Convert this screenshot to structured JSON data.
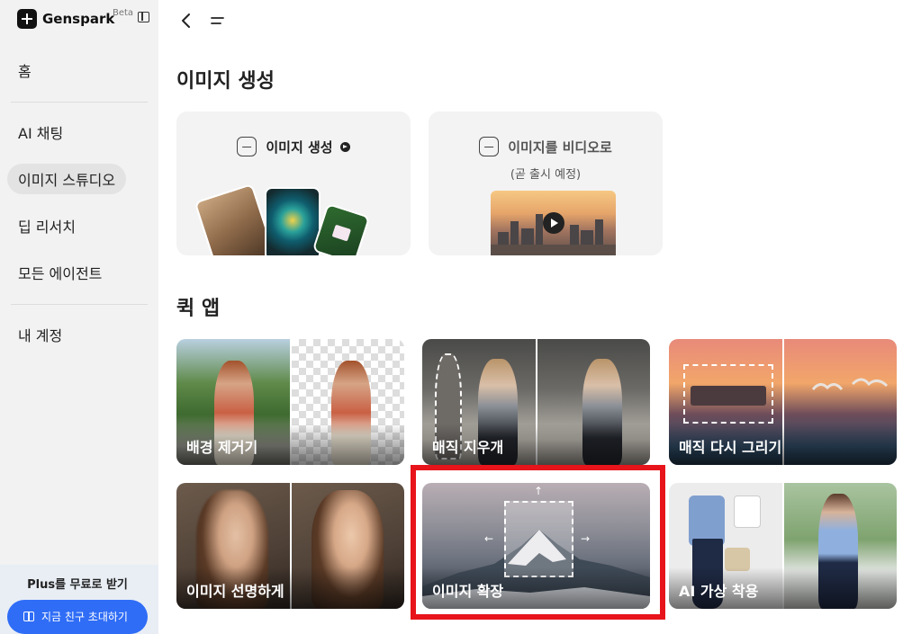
{
  "sidebar": {
    "brand_name": "Genspark",
    "beta_badge": "Beta",
    "items": [
      {
        "label": "홈"
      },
      {
        "label": "AI 채팅"
      },
      {
        "label": "이미지 스튜디오"
      },
      {
        "label": "딥 리서치"
      },
      {
        "label": "모든 에이전트"
      },
      {
        "label": "내 계정"
      }
    ],
    "active_item": "이미지 스튜디오",
    "promo": {
      "title": "Plus를 무료로 받기",
      "button_label": "지금 친구 초대하기"
    }
  },
  "main": {
    "image_gen_title": "이미지 생성",
    "cards": [
      {
        "label": "이미지 생성"
      },
      {
        "label": "이미지를 비디오로",
        "sublabel": "(곧 출시 예정)"
      }
    ],
    "quick_apps_title": "퀵 앱",
    "quick_apps": [
      {
        "label": "배경 제거기"
      },
      {
        "label": "매직 지우개"
      },
      {
        "label": "매직 다시 그리기"
      },
      {
        "label": "이미지 선명하게"
      },
      {
        "label": "이미지 확장"
      },
      {
        "label": "AI 가상 착용"
      }
    ],
    "highlighted_app": "이미지 확장"
  },
  "colors": {
    "highlight_border": "#e8141b",
    "promo_button": "#2f6df6",
    "sidebar_bg": "#f2f2f2"
  }
}
